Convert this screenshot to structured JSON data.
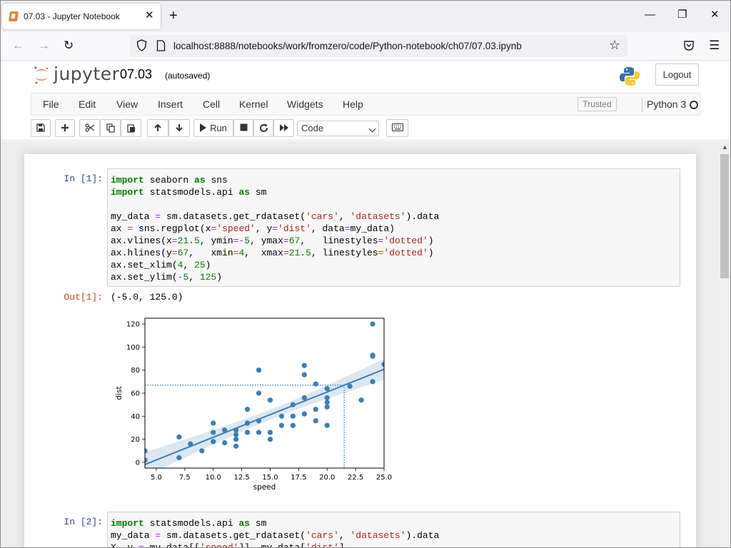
{
  "browser": {
    "tab_title": "07.03 - Jupyter Notebook",
    "url": "localhost:8888/notebooks/work/fromzero/code/Python-notebook/ch07/07.03.ipynb"
  },
  "jupyter": {
    "logo_text": "jupyter",
    "notebook_name": "07.03",
    "save_status": "(autosaved)",
    "logout_label": "Logout",
    "menu": [
      "File",
      "Edit",
      "View",
      "Insert",
      "Cell",
      "Kernel",
      "Widgets",
      "Help"
    ],
    "trusted_label": "Trusted",
    "kernel_name": "Python 3",
    "run_label": "Run",
    "cell_type": "Code"
  },
  "cells": {
    "cell1_prompt": "In [1]:",
    "cell1_out_prompt": "Out[1]:",
    "cell1_output": "(-5.0, 125.0)",
    "cell2_prompt": "In [2]:"
  },
  "chart_data": {
    "type": "scatter",
    "title": "",
    "xlabel": "speed",
    "ylabel": "dist",
    "xlim": [
      4,
      25
    ],
    "ylim": [
      -5,
      125
    ],
    "xticks": [
      "5.0",
      "7.5",
      "10.0",
      "12.5",
      "15.0",
      "17.5",
      "20.0",
      "22.5",
      "25.0"
    ],
    "yticks": [
      "0",
      "20",
      "40",
      "60",
      "80",
      "100",
      "120"
    ],
    "points": [
      [
        4,
        2
      ],
      [
        4,
        10
      ],
      [
        7,
        4
      ],
      [
        7,
        22
      ],
      [
        8,
        16
      ],
      [
        9,
        10
      ],
      [
        10,
        18
      ],
      [
        10,
        26
      ],
      [
        10,
        34
      ],
      [
        11,
        17
      ],
      [
        11,
        28
      ],
      [
        12,
        14
      ],
      [
        12,
        20
      ],
      [
        12,
        24
      ],
      [
        12,
        28
      ],
      [
        13,
        26
      ],
      [
        13,
        34
      ],
      [
        13,
        34
      ],
      [
        13,
        46
      ],
      [
        14,
        26
      ],
      [
        14,
        36
      ],
      [
        14,
        60
      ],
      [
        14,
        80
      ],
      [
        15,
        20
      ],
      [
        15,
        26
      ],
      [
        15,
        54
      ],
      [
        16,
        32
      ],
      [
        16,
        40
      ],
      [
        17,
        32
      ],
      [
        17,
        40
      ],
      [
        17,
        50
      ],
      [
        18,
        42
      ],
      [
        18,
        56
      ],
      [
        18,
        76
      ],
      [
        18,
        84
      ],
      [
        19,
        36
      ],
      [
        19,
        46
      ],
      [
        19,
        68
      ],
      [
        20,
        32
      ],
      [
        20,
        48
      ],
      [
        20,
        52
      ],
      [
        20,
        56
      ],
      [
        20,
        64
      ],
      [
        22,
        66
      ],
      [
        23,
        54
      ],
      [
        24,
        70
      ],
      [
        24,
        92
      ],
      [
        24,
        93
      ],
      [
        24,
        120
      ],
      [
        25,
        85
      ]
    ],
    "regression": {
      "intercept": -17.58,
      "slope": 3.93
    },
    "vline": {
      "x": 21.5,
      "ymin": -5,
      "ymax": 67
    },
    "hline": {
      "y": 67,
      "xmin": 4,
      "xmax": 21.5
    },
    "color": "#3a7fb5"
  }
}
